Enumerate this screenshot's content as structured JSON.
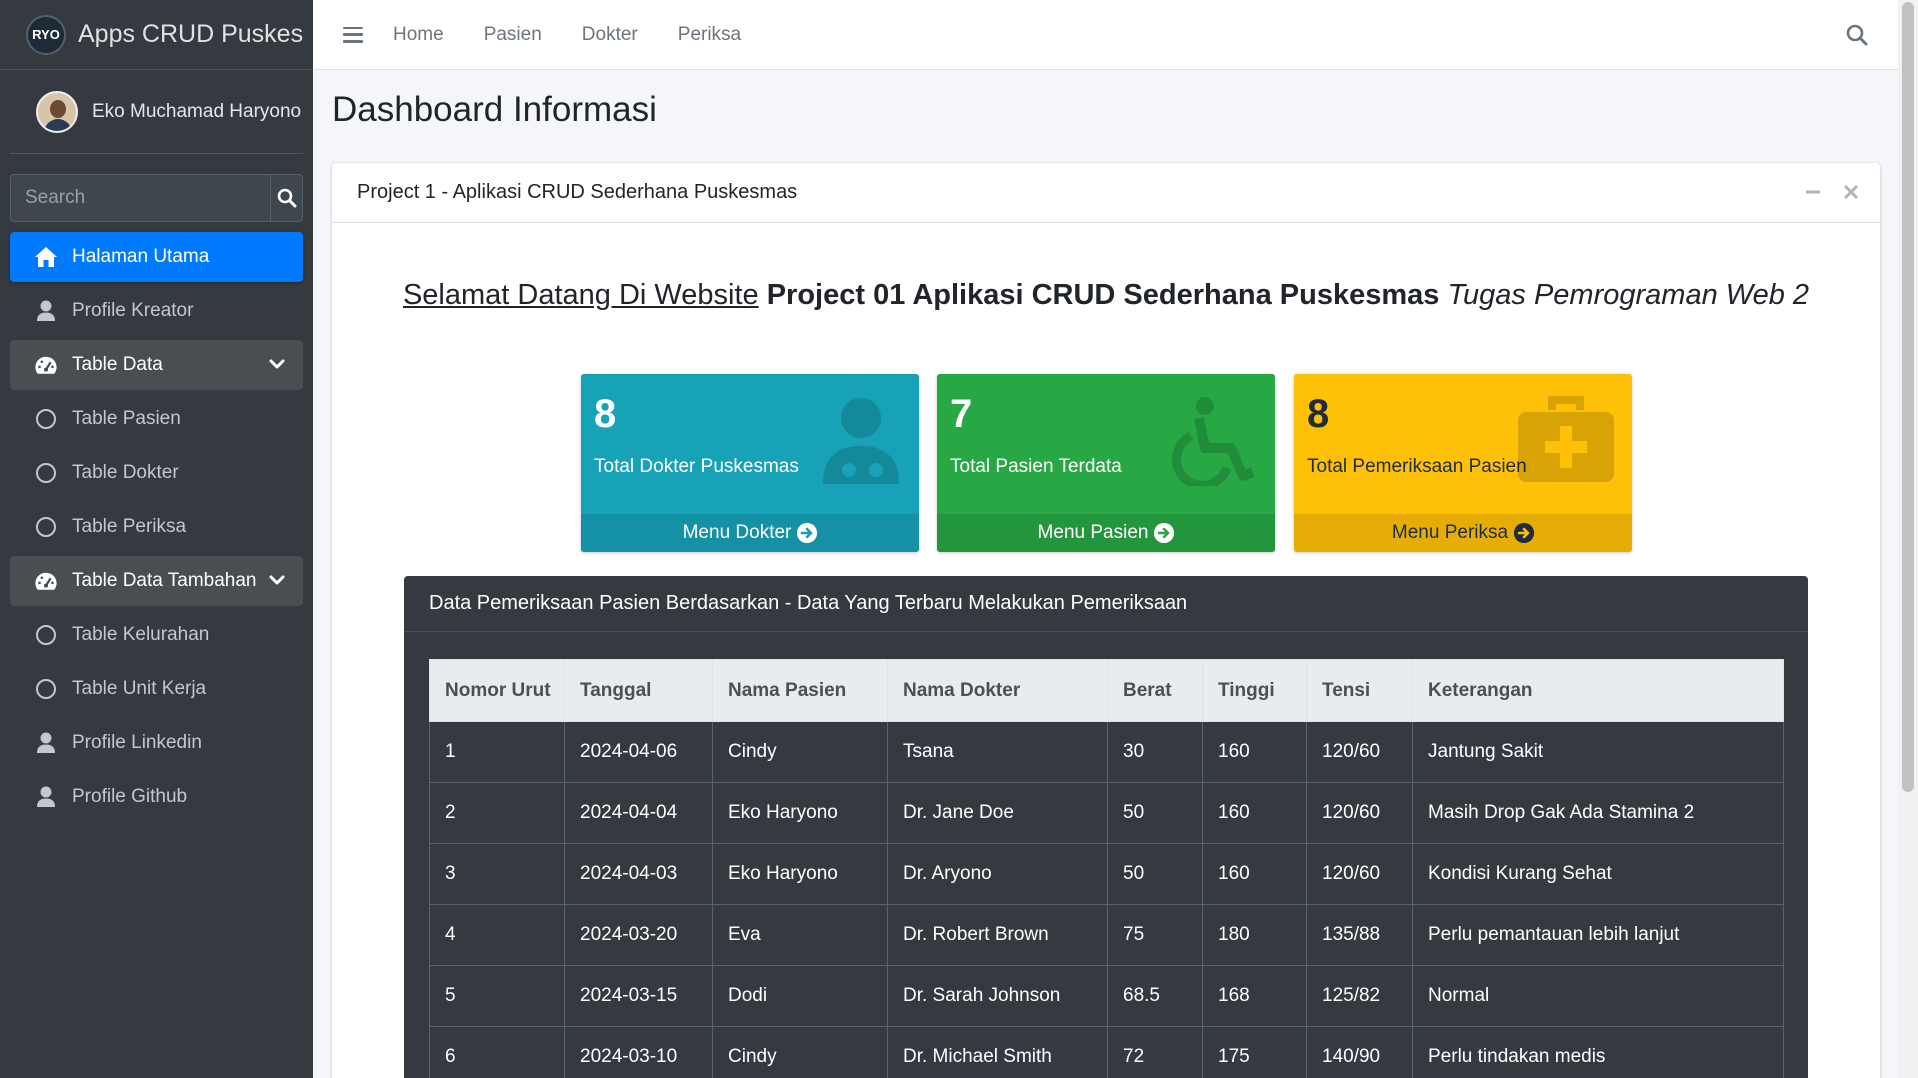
{
  "brand": {
    "title": "Apps CRUD Puskes",
    "logo_text": "RYO"
  },
  "user": {
    "name": "Eko Muchamad Haryono"
  },
  "sidebar_search": {
    "placeholder": "Search"
  },
  "sidebar": {
    "items": [
      {
        "label": "Halaman Utama",
        "icon": "home-icon",
        "state": "active"
      },
      {
        "label": "Profile Kreator",
        "icon": "user-icon"
      },
      {
        "label": "Table Data",
        "icon": "dashboard-icon",
        "state": "open"
      },
      {
        "label": "Table Pasien",
        "icon": "circle-icon"
      },
      {
        "label": "Table Dokter",
        "icon": "circle-icon"
      },
      {
        "label": "Table Periksa",
        "icon": "circle-icon"
      },
      {
        "label": "Table Data Tambahan",
        "icon": "dashboard-icon",
        "state": "open"
      },
      {
        "label": "Table Kelurahan",
        "icon": "circle-icon"
      },
      {
        "label": "Table Unit Kerja",
        "icon": "circle-icon"
      },
      {
        "label": "Profile Linkedin",
        "icon": "user-icon"
      },
      {
        "label": "Profile Github",
        "icon": "user-icon"
      }
    ]
  },
  "topnav": {
    "links": [
      "Home",
      "Pasien",
      "Dokter",
      "Periksa"
    ]
  },
  "page": {
    "title": "Dashboard Informasi"
  },
  "card": {
    "title": "Project 1 - Aplikasi CRUD Sederhana Puskesmas",
    "welcome_underline": "Selamat Datang Di Website",
    "welcome_bold": "Project 01 Aplikasi CRUD Sederhana Puskesmas",
    "welcome_italic": "Tugas Pemrograman Web 2"
  },
  "stats": [
    {
      "value": "8",
      "label": "Total Dokter Puskesmas",
      "link": "Menu Dokter",
      "color": "#17a2b8",
      "icon": "doctor-icon"
    },
    {
      "value": "7",
      "label": "Total Pasien Terdata",
      "link": "Menu Pasien",
      "color": "#28a745",
      "icon": "wheelchair-icon"
    },
    {
      "value": "8",
      "label": "Total Pemeriksaan Pasien",
      "link": "Menu Periksa",
      "color": "#ffc107",
      "icon": "medkit-icon"
    }
  ],
  "table": {
    "title": "Data Pemeriksaan Pasien Berdasarkan - Data Yang Terbaru Melakukan Pemeriksaan",
    "headers": [
      "Nomor Urut",
      "Tanggal",
      "Nama Pasien",
      "Nama Dokter",
      "Berat",
      "Tinggi",
      "Tensi",
      "Keterangan"
    ],
    "rows": [
      [
        "1",
        "2024-04-06",
        "Cindy",
        "Tsana",
        "30",
        "160",
        "120/60",
        "Jantung Sakit"
      ],
      [
        "2",
        "2024-04-04",
        "Eko Haryono",
        "Dr. Jane Doe",
        "50",
        "160",
        "120/60",
        "Masih Drop Gak Ada Stamina 2"
      ],
      [
        "3",
        "2024-04-03",
        "Eko Haryono",
        "Dr. Aryono",
        "50",
        "160",
        "120/60",
        "Kondisi Kurang Sehat"
      ],
      [
        "4",
        "2024-03-20",
        "Eva",
        "Dr. Robert Brown",
        "75",
        "180",
        "135/88",
        "Perlu pemantauan lebih lanjut"
      ],
      [
        "5",
        "2024-03-15",
        "Dodi",
        "Dr. Sarah Johnson",
        "68.5",
        "168",
        "125/82",
        "Normal"
      ],
      [
        "6",
        "2024-03-10",
        "Cindy",
        "Dr. Michael Smith",
        "72",
        "175",
        "140/90",
        "Perlu tindakan medis"
      ]
    ]
  }
}
